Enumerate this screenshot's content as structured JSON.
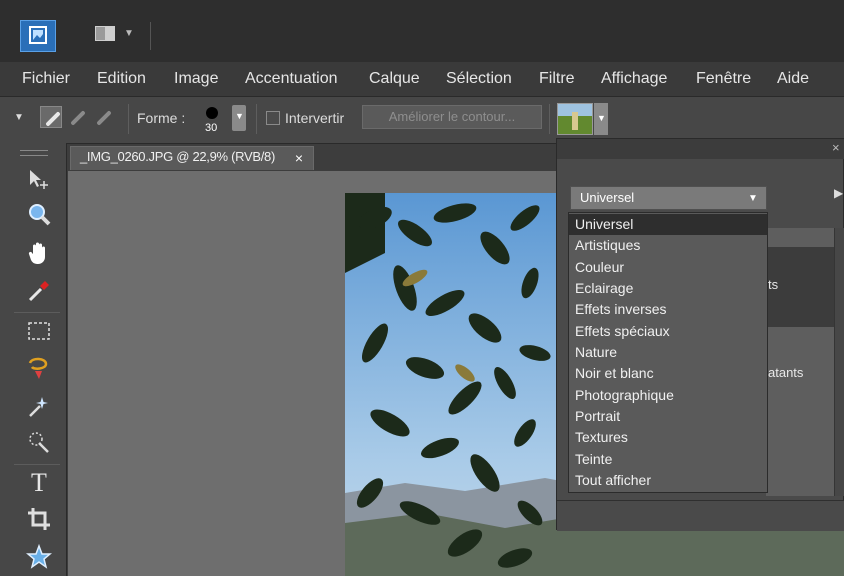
{
  "menu": [
    "Fichier",
    "Edition",
    "Image",
    "Accentuation",
    "Calque",
    "Sélection",
    "Filtre",
    "Affichage",
    "Fenêtre",
    "Aide"
  ],
  "options": {
    "forme_label": "Forme :",
    "brush_size": "30",
    "invert_label": "Intervertir",
    "refine_button": "Améliorer le contour..."
  },
  "document": {
    "tab_label": "_IMG_0260.JPG @ 22,9% (RVB/8)",
    "close_glyph": "×"
  },
  "effects_panel": {
    "close_glyph": "×",
    "selected_category": "Universel",
    "list_partial_1": "ts",
    "list_partial_2": "atants",
    "categories": [
      "Universel",
      "Artistiques",
      "Couleur",
      "Eclairage",
      "Effets inverses",
      "Effets spéciaux",
      "Nature",
      "Noir et blanc",
      "Photographique",
      "Portrait",
      "Textures",
      "Teinte",
      "Tout afficher"
    ]
  },
  "colors": {
    "app_icon": "#2a6fb8",
    "selected_option": "#2e2e2e"
  },
  "icons": [
    "app-icon",
    "layout-icon",
    "brush-icon",
    "move-tool-icon",
    "zoom-icon",
    "hand-icon",
    "eyedropper-icon",
    "marquee-icon",
    "lasso-icon",
    "magic-wand-icon",
    "quick-selection-icon",
    "text-icon",
    "crop-icon",
    "shape-icon"
  ]
}
